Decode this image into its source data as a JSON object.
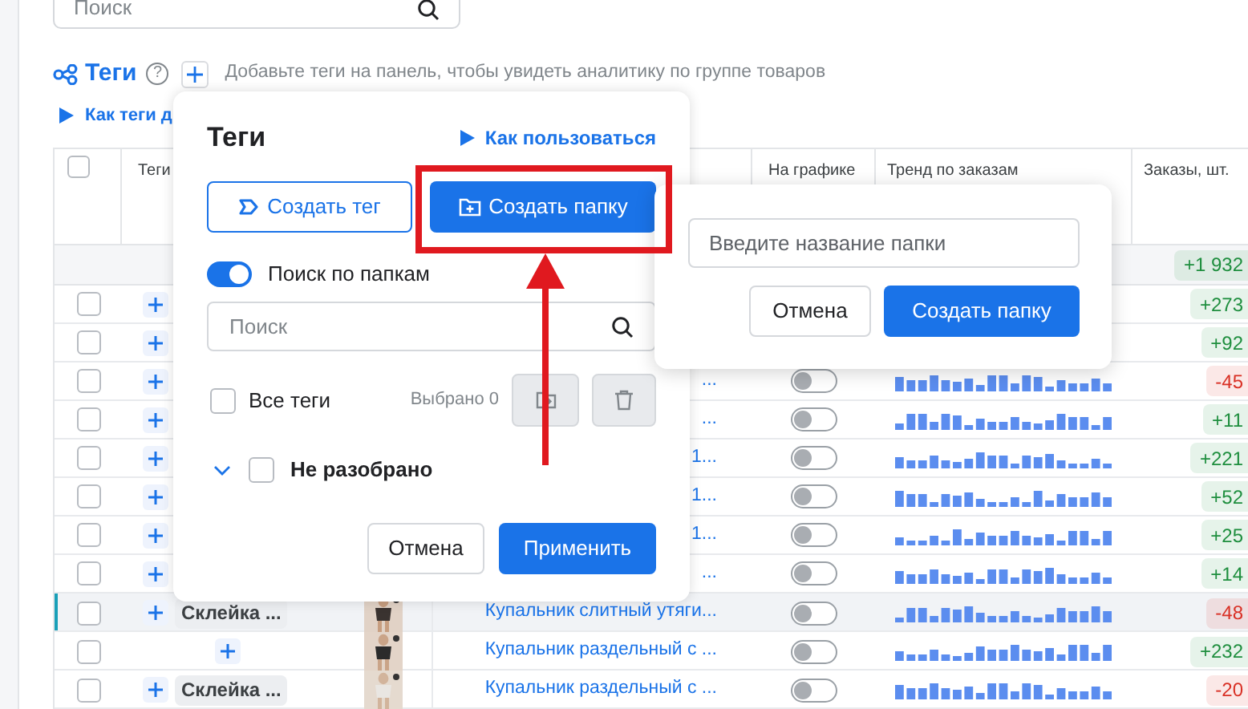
{
  "page_search": {
    "placeholder": "Поиск"
  },
  "tags_header": {
    "title": "Теги",
    "help": "?",
    "hint": "Добавьте теги на панель, чтобы увидеть аналитику по группе товаров"
  },
  "help_link": "Как теги д",
  "table": {
    "header_checked": false,
    "tags_column": "Теги",
    "chart_column": "На графике",
    "trend_column": "Тренд по заказам",
    "orders_column": "Заказы, шт.",
    "summary": {
      "orders": "+1 932",
      "color": "#1e8e3e"
    },
    "rows": [
      {
        "checked": false,
        "highlighted": false,
        "nested": false,
        "orders": "+273",
        "color": "#1e8e3e"
      },
      {
        "checked": false,
        "highlighted": false,
        "nested": false,
        "orders": "+92",
        "color": "#1e8e3e"
      },
      {
        "checked": false,
        "highlighted": false,
        "nested": false,
        "name": "...",
        "chart_toggle": {
          "on": false
        },
        "orders": "-45",
        "color": "#d93025"
      },
      {
        "checked": false,
        "highlighted": false,
        "nested": false,
        "name": "...",
        "chart_toggle": {
          "on": false
        },
        "orders": "+11",
        "color": "#1e8e3e"
      },
      {
        "checked": false,
        "highlighted": false,
        "nested": false,
        "name": "1...",
        "chart_toggle": {
          "on": false
        },
        "orders": "+221",
        "color": "#1e8e3e"
      },
      {
        "checked": false,
        "highlighted": false,
        "nested": false,
        "name": "1...",
        "chart_toggle": {
          "on": false
        },
        "orders": "+52",
        "color": "#1e8e3e"
      },
      {
        "checked": false,
        "highlighted": false,
        "nested": false,
        "name": "1...",
        "chart_toggle": {
          "on": false
        },
        "orders": "+25",
        "color": "#1e8e3e"
      },
      {
        "checked": false,
        "highlighted": false,
        "nested": false,
        "name": "...",
        "chart_toggle": {
          "on": false
        },
        "orders": "+14",
        "color": "#1e8e3e"
      },
      {
        "checked": false,
        "highlighted": true,
        "nested": false,
        "tag": "Склейка ...",
        "name": "Купальник слитный утяги...",
        "chart_toggle": {
          "on": false
        },
        "orders": "-48",
        "color": "#d93025"
      },
      {
        "checked": false,
        "highlighted": false,
        "nested": true,
        "name": "Купальник раздельный с ...",
        "chart_toggle": {
          "on": false
        },
        "orders": "+232",
        "color": "#1e8e3e"
      },
      {
        "checked": false,
        "highlighted": false,
        "nested": false,
        "tag": "Склейка ...",
        "name": "Купальник раздельный с ...",
        "chart_toggle": {
          "on": false
        },
        "orders": "-20",
        "color": "#d93025"
      }
    ]
  },
  "tags_popup": {
    "title": "Теги",
    "how_to_link": "Как пользоваться",
    "create_tag_button": "Создать тег",
    "create_folder_button": "Создать папку",
    "folder_search": {
      "label": "Поиск по папкам",
      "on": true
    },
    "search": {
      "placeholder": "Поиск"
    },
    "all_tags": {
      "label": "Все теги",
      "checked": false
    },
    "selected_count": "Выбрано 0",
    "tree": [
      {
        "label": "Не разобрано",
        "checked": false,
        "expanded": false
      }
    ],
    "cancel_button": "Отмена",
    "apply_button": "Применить"
  },
  "folder_popup": {
    "name_field": {
      "placeholder": "Введите название папки"
    },
    "cancel_button": "Отмена",
    "create_button": "Создать папку"
  }
}
